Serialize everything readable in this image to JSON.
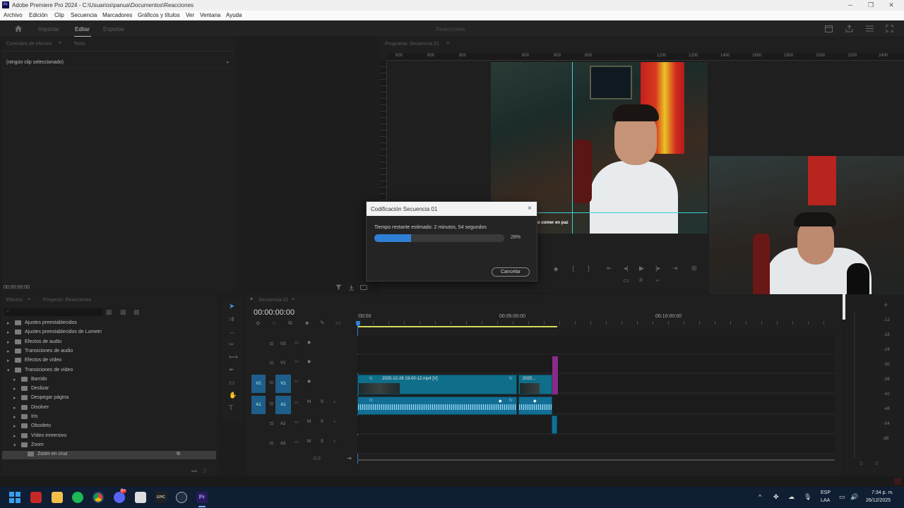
{
  "window": {
    "app_icon": "Pr",
    "title": "Adobe Premiere Pro 2024 - C:\\Usuarios\\panua\\Documentos\\Reacciones"
  },
  "menu": [
    "Archivo",
    "Edición",
    "Clip",
    "Secuencia",
    "Marcadores",
    "Gráficos y títulos",
    "Ver",
    "Ventana",
    "Ayuda"
  ],
  "workspace": {
    "tabs": [
      "Importar",
      "Editar",
      "Exportar"
    ],
    "active_tab": "Editar",
    "project_name": "Reacciones"
  },
  "effect_controls": {
    "tabs": [
      "Controles de efectos",
      "Texto"
    ],
    "no_clip": "(ningún clip seleccionado)",
    "timecode": "00:00:00:00"
  },
  "program_monitor": {
    "tab": "Programa: Secuencia 01",
    "ruler": [
      "600",
      "800",
      "1000",
      "1200",
      "1400",
      "1600",
      "1800",
      "2000",
      "2200",
      "2400"
    ],
    "subtitle_fragment": "o comer en paz"
  },
  "effects_panel": {
    "tabs": [
      "Efectos",
      "Proyecto: Reacciones"
    ],
    "tree": [
      {
        "label": "Ajustes preestablecidos",
        "level": 0,
        "expanded": false,
        "type": "preset"
      },
      {
        "label": "Ajustes preestablecidos de Lumetri",
        "level": 0,
        "expanded": false,
        "type": "preset"
      },
      {
        "label": "Efectos de audio",
        "level": 0,
        "expanded": false,
        "type": "folder"
      },
      {
        "label": "Transiciones de audio",
        "level": 0,
        "expanded": false,
        "type": "folder"
      },
      {
        "label": "Efectos de vídeo",
        "level": 0,
        "expanded": false,
        "type": "folder"
      },
      {
        "label": "Transiciones de vídeo",
        "level": 0,
        "expanded": true,
        "type": "folder"
      },
      {
        "label": "Barrido",
        "level": 1,
        "expanded": false,
        "type": "folder"
      },
      {
        "label": "Deslizar",
        "level": 1,
        "expanded": false,
        "type": "folder"
      },
      {
        "label": "Despegar página",
        "level": 1,
        "expanded": false,
        "type": "folder"
      },
      {
        "label": "Disolver",
        "level": 1,
        "expanded": false,
        "type": "folder"
      },
      {
        "label": "Iris",
        "level": 1,
        "expanded": false,
        "type": "folder"
      },
      {
        "label": "Obsoleto",
        "level": 1,
        "expanded": false,
        "type": "folder"
      },
      {
        "label": "Vídeo inmersivo",
        "level": 1,
        "expanded": false,
        "type": "folder"
      },
      {
        "label": "Zoom",
        "level": 1,
        "expanded": true,
        "type": "folder"
      },
      {
        "label": "Zoom en cruz",
        "level": 2,
        "expanded": false,
        "type": "effect"
      }
    ]
  },
  "timeline": {
    "tab": "Secuencia 01",
    "timecode": "00:00:00:00",
    "ruler": [
      ":00:00",
      "00:05:00:00",
      "00:10:00:00"
    ],
    "tracks": [
      {
        "src": "",
        "name": "V3"
      },
      {
        "src": "",
        "name": "V2"
      },
      {
        "src": "V1",
        "name": "V1"
      },
      {
        "src": "A1",
        "name": "A1"
      },
      {
        "src": "",
        "name": "A2"
      },
      {
        "src": "",
        "name": "A3"
      }
    ],
    "clip1": "2025-12-26 19-00-12.mp4 [V]",
    "clip2": "2025...",
    "mix_value": "0.0"
  },
  "audio_meter": {
    "scale": [
      "-6",
      "-12",
      "-18",
      "-24",
      "-30",
      "-36",
      "-42",
      "-48",
      "-54",
      "dB"
    ]
  },
  "dialog": {
    "title": "Codificación Secuencia 01",
    "message": "Tiempo restante estimado: 2 minutos, 54 segundos",
    "progress": 0.28,
    "progress_label": "28%",
    "cancel": "Cancelar"
  },
  "taskbar": {
    "lang": "ESP",
    "layout": "LAA",
    "time": "7:34 p. m.",
    "date": "26/12/2025",
    "chat_badge": "9+"
  },
  "colors": {
    "accent": "#2f7fd6",
    "clip_video": "#0f6e8a",
    "clip_audio": "#126e94",
    "marker_purple": "#8a2a8a",
    "track_src": "#1d5e8a"
  }
}
